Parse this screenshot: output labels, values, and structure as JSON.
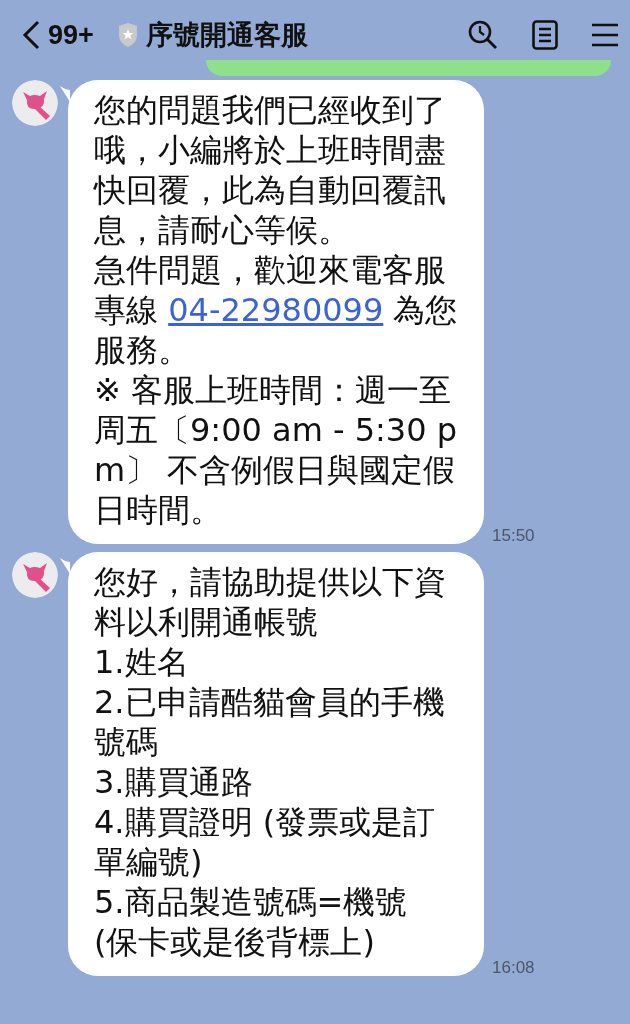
{
  "header": {
    "unread_count": "99+",
    "title": "序號開通客服"
  },
  "messages": [
    {
      "paragraphs": [
        {
          "text": "您的問題我們已經收到了哦，小編將於上班時間盡快回覆，此為自動回覆訊息，請耐心等候。"
        },
        {
          "text": "急件問題，歡迎來電客服專線 ",
          "link": "04-22980099",
          "after": " 為您服務。"
        },
        {
          "text": "※ 客服上班時間：週一至周五〔9:00 am - 5:30 pm〕 不含例假日與國定假日時間。"
        }
      ],
      "time": "15:50"
    },
    {
      "paragraphs": [
        {
          "text": "您好，請協助提供以下資料以利開通帳號"
        },
        {
          "text": "1.姓名"
        },
        {
          "text": "2.已申請酷貓會員的手機號碼"
        },
        {
          "text": "3.購買通路"
        },
        {
          "text": "4.購買證明 (發票或是訂單編號)"
        },
        {
          "text": "5.商品製造號碼=機號 (保卡或是後背標上)"
        }
      ],
      "time": "16:08"
    }
  ]
}
